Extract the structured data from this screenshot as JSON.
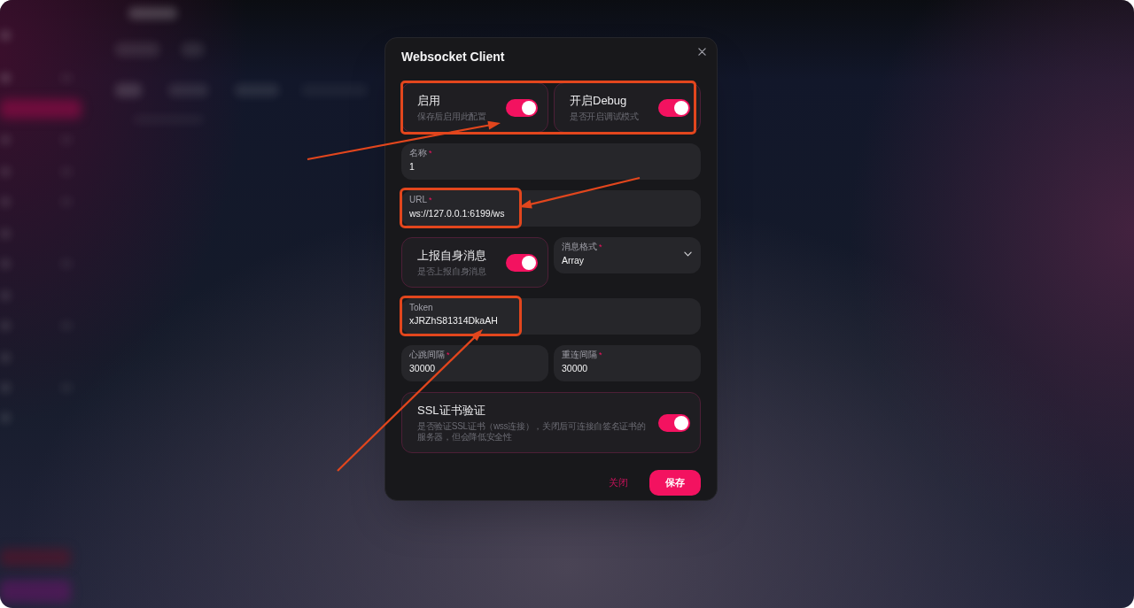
{
  "dialog": {
    "title": "Websocket Client",
    "rows": [
      {
        "highlighted": true,
        "items": [
          {
            "kind": "switch",
            "label": "启用",
            "description": "保存后启用此配置",
            "on": true,
            "highlighted": false
          },
          {
            "kind": "switch",
            "label": "开启Debug",
            "description": "是否开启调试模式",
            "on": true,
            "highlighted": false
          }
        ]
      },
      {
        "highlighted": false,
        "items": [
          {
            "kind": "input",
            "label": "名称",
            "mark": "*",
            "value": "1",
            "highlighted": false
          }
        ]
      },
      {
        "highlighted": false,
        "items": [
          {
            "kind": "input",
            "label": "URL",
            "mark": "*",
            "value": "ws://127.0.0.1:6199/ws",
            "highlighted": true
          }
        ]
      },
      {
        "highlighted": false,
        "items": [
          {
            "kind": "switch",
            "label": "上报自身消息",
            "description": "是否上报自身消息",
            "on": true,
            "highlighted": false
          },
          {
            "kind": "select",
            "label": "消息格式",
            "mark": "*",
            "value": "Array",
            "highlighted": false
          }
        ]
      },
      {
        "highlighted": false,
        "items": [
          {
            "kind": "input",
            "label": "Token",
            "value": "xJRZhS81314DkaAH",
            "highlighted": true
          }
        ]
      },
      {
        "highlighted": false,
        "items": [
          {
            "kind": "input",
            "label": "心跳间隔",
            "mark": "*",
            "value": "30000",
            "highlighted": false
          },
          {
            "kind": "input",
            "label": "重连间隔",
            "mark": "*",
            "value": "30000",
            "highlighted": false
          }
        ]
      },
      {
        "highlighted": false,
        "items": [
          {
            "kind": "switch",
            "label": "SSL证书验证",
            "description": "是否验证SSL证书（wss连接），关闭后可连接自签名证书的服务器，但会降低安全性",
            "on": true,
            "highlighted": false
          }
        ]
      }
    ],
    "buttons": [
      {
        "kind": "text",
        "label": "关闭"
      },
      {
        "kind": "primary",
        "label": "保存"
      }
    ]
  }
}
